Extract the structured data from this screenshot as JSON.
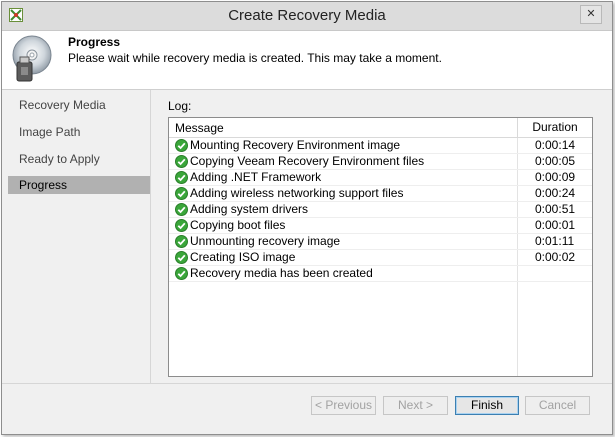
{
  "window": {
    "title": "Create Recovery Media",
    "close_glyph": "✕"
  },
  "header": {
    "title": "Progress",
    "description": "Please wait while recovery media is created. This may take a moment."
  },
  "sidebar": {
    "items": [
      {
        "label": "Recovery Media",
        "active": false
      },
      {
        "label": "Image Path",
        "active": false
      },
      {
        "label": "Ready to Apply",
        "active": false
      },
      {
        "label": "Progress",
        "active": true
      }
    ]
  },
  "log": {
    "label": "Log:",
    "columns": {
      "message": "Message",
      "duration": "Duration"
    },
    "rows": [
      {
        "message": "Mounting Recovery Environment image",
        "duration": "0:00:14",
        "status": "success"
      },
      {
        "message": "Copying Veeam Recovery Environment files",
        "duration": "0:00:05",
        "status": "success"
      },
      {
        "message": "Adding .NET Framework",
        "duration": "0:00:09",
        "status": "success"
      },
      {
        "message": "Adding wireless networking support files",
        "duration": "0:00:24",
        "status": "success"
      },
      {
        "message": "Adding system drivers",
        "duration": "0:00:51",
        "status": "success"
      },
      {
        "message": "Copying boot files",
        "duration": "0:00:01",
        "status": "success"
      },
      {
        "message": "Unmounting recovery image",
        "duration": "0:01:11",
        "status": "success"
      },
      {
        "message": "Creating ISO image",
        "duration": "0:00:02",
        "status": "success"
      },
      {
        "message": "Recovery media has been created",
        "duration": "",
        "status": "success"
      }
    ]
  },
  "buttons": {
    "previous": "< Previous",
    "next": "Next >",
    "finish": "Finish",
    "cancel": "Cancel"
  },
  "colors": {
    "success": "#3aa63a",
    "active_step": "#b1b1b1"
  }
}
